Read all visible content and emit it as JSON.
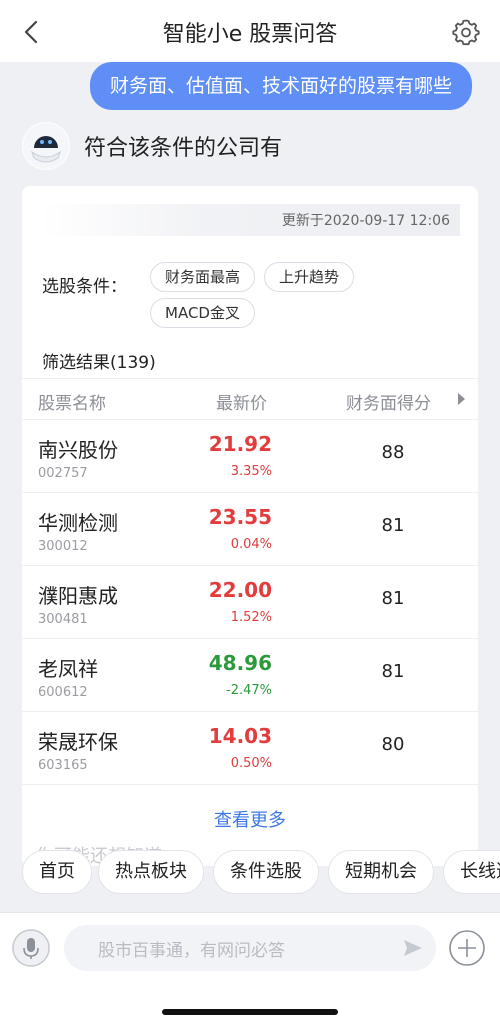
{
  "header": {
    "title": "智能小e  股票问答"
  },
  "chat": {
    "user_message": "财务面、估值面、技术面好的股票有哪些",
    "bot_message": "符合该条件的公司有"
  },
  "card": {
    "update_time": "更新于2020-09-17 12:06",
    "condition_label": "选股条件：",
    "conditions": [
      "财务面最高",
      "上升趋势",
      "MACD金叉"
    ],
    "result_title": "筛选结果(139)",
    "columns": [
      "股票名称",
      "最新价",
      "财务面得分"
    ],
    "rows": [
      {
        "name": "南兴股份",
        "code": "002757",
        "price": "21.92",
        "change": "3.35%",
        "score": "88",
        "trend": "up"
      },
      {
        "name": "华测检测",
        "code": "300012",
        "price": "23.55",
        "change": "0.04%",
        "score": "81",
        "trend": "up"
      },
      {
        "name": "濮阳惠成",
        "code": "300481",
        "price": "22.00",
        "change": "1.52%",
        "score": "81",
        "trend": "up"
      },
      {
        "name": "老凤祥",
        "code": "600612",
        "price": "48.96",
        "change": "-2.47%",
        "score": "81",
        "trend": "down"
      },
      {
        "name": "荣晟环保",
        "code": "603165",
        "price": "14.03",
        "change": "0.50%",
        "score": "80",
        "trend": "up"
      }
    ],
    "more_label": "查看更多",
    "faded_text": "你可能还想知道"
  },
  "quick_actions": [
    "首页",
    "热点板块",
    "条件选股",
    "短期机会",
    "长线选"
  ],
  "input": {
    "placeholder": "股市百事通，有网问必答"
  },
  "colors": {
    "accent": "#5e8ef6",
    "up": "#e23c3c",
    "down": "#2c9a3b",
    "link": "#3d78e6"
  }
}
